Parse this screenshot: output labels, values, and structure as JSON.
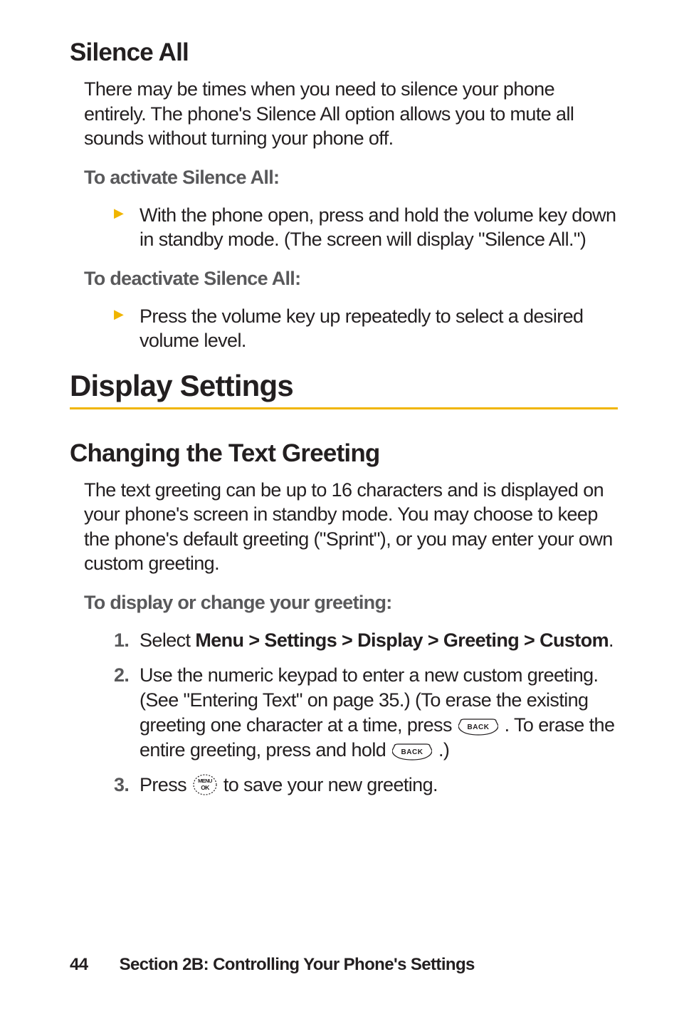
{
  "silence": {
    "heading": "Silence All",
    "intro": "There may be times when you need to silence your phone entirely. The phone's Silence All option allows you to mute all sounds without turning your phone off.",
    "activate_lead": "To activate Silence All:",
    "activate_item": "With the phone open, press and hold the volume key down in standby mode. (The screen will display \"Silence All.\")",
    "deactivate_lead": "To deactivate Silence All:",
    "deactivate_item": "Press the volume key up repeatedly to select a desired volume level."
  },
  "display": {
    "heading": "Display Settings",
    "greeting_heading": "Changing the Text Greeting",
    "greeting_intro": "The text greeting can be up to 16 characters and is displayed on your phone's screen in standby mode. You may choose to keep the phone's default greeting (\"Sprint\"), or you may enter your own custom greeting.",
    "greeting_lead": "To display or change your greeting:",
    "step1_prefix": "Select ",
    "step1_bold": "Menu > Settings > Display > Greeting > Custom",
    "step1_suffix": ".",
    "step2_a": "Use the numeric keypad to enter a new custom greeting. (See \"Entering Text\" on page 35.) (To erase the existing greeting one character at a time, press ",
    "step2_b": " . To erase the entire greeting, press and hold ",
    "step2_c": " .)",
    "step3_a": "Press ",
    "step3_b": " to save your new greeting."
  },
  "icons": {
    "back": "BACK",
    "menu_ok": "MENU OK"
  },
  "footer": {
    "page": "44",
    "section": "Section 2B: Controlling Your Phone's Settings"
  }
}
